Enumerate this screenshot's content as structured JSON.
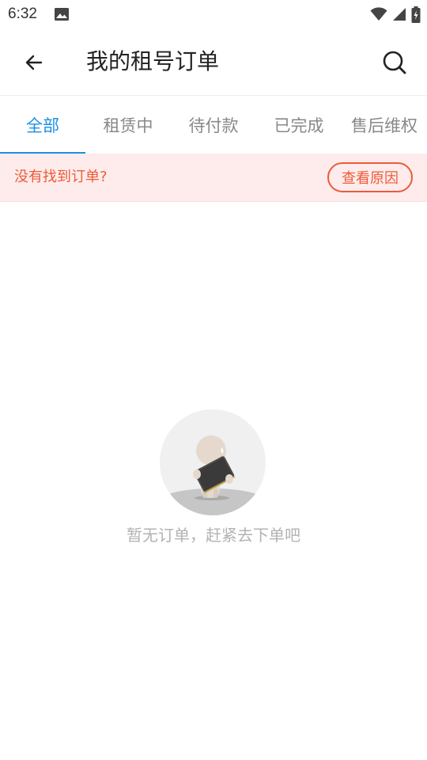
{
  "status_bar": {
    "time": "6:32",
    "icons": [
      "image-icon",
      "wifi-icon",
      "signal-icon",
      "battery-charging-icon"
    ]
  },
  "app_bar": {
    "title": "我的租号订单",
    "back_icon": "arrow-left-icon",
    "search_icon": "search-icon"
  },
  "tabs": [
    {
      "label": "全部",
      "active": true
    },
    {
      "label": "租赁中",
      "active": false
    },
    {
      "label": "待付款",
      "active": false
    },
    {
      "label": "已完成",
      "active": false
    },
    {
      "label": "售后维权",
      "active": false
    }
  ],
  "notice": {
    "text": "没有找到订单?",
    "button_label": "查看原因"
  },
  "empty_state": {
    "message": "暂无订单，赶紧去下单吧",
    "illustration": "empty-orders-illustration"
  },
  "colors": {
    "accent": "#1a8fe3",
    "warning": "#ee5a3a",
    "notice_bg": "#fdeceb",
    "muted_text": "#b3b3b3"
  }
}
